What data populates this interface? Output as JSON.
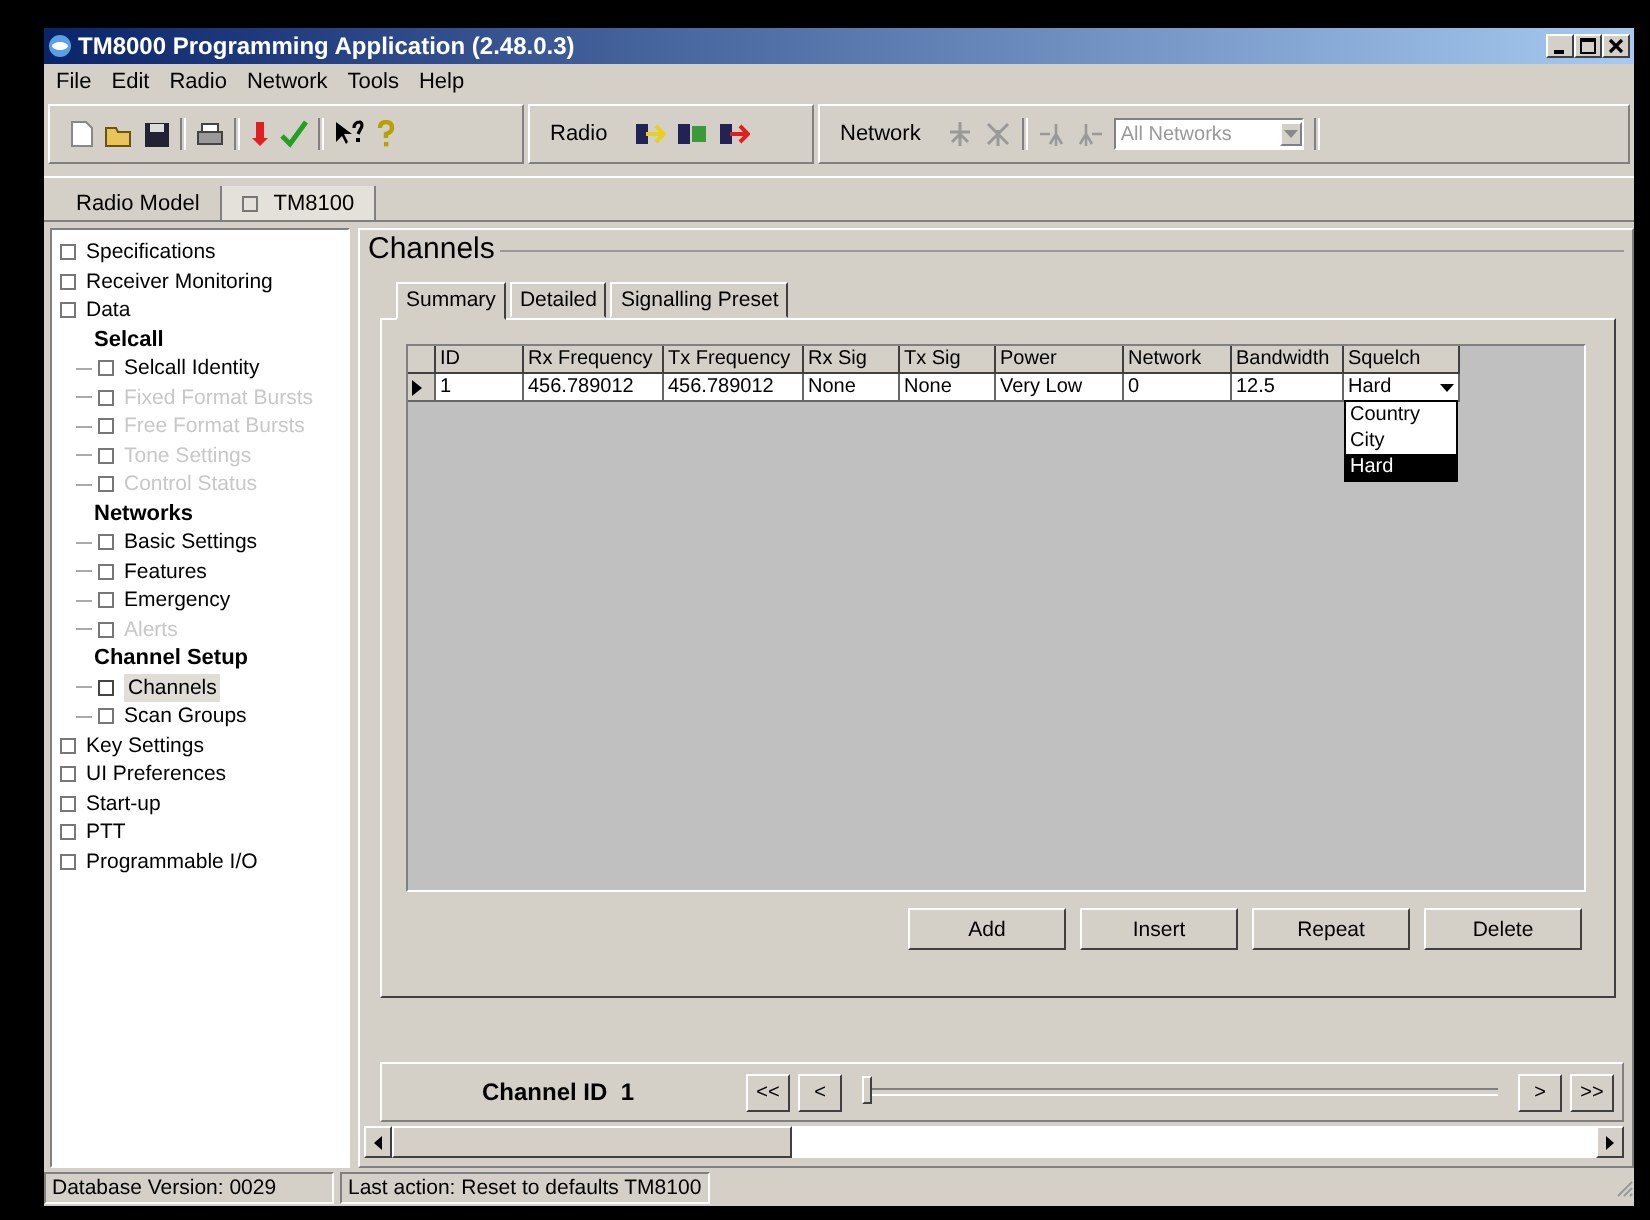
{
  "window": {
    "title": "TM8000 Programming Application (2.48.0.3)"
  },
  "menu": [
    "File",
    "Edit",
    "Radio",
    "Network",
    "Tools",
    "Help"
  ],
  "toolbar": {
    "radio_label": "Radio",
    "network_label": "Network",
    "network_select": {
      "value": "All Networks",
      "disabled": true
    }
  },
  "model_tabs": [
    {
      "label": "Radio Model",
      "selected": false
    },
    {
      "label": "TM8100",
      "selected": true
    }
  ],
  "sidebar": {
    "items": [
      {
        "kind": "item",
        "label": "Specifications",
        "disabled": false,
        "selected": false
      },
      {
        "kind": "item",
        "label": "Receiver Monitoring",
        "disabled": false,
        "selected": false
      },
      {
        "kind": "item",
        "label": "Data",
        "disabled": false,
        "selected": false
      },
      {
        "kind": "group",
        "label": "Selcall",
        "children": [
          {
            "label": "Selcall Identity",
            "disabled": false,
            "selected": false
          },
          {
            "label": "Fixed Format Bursts",
            "disabled": true,
            "selected": false
          },
          {
            "label": "Free Format Bursts",
            "disabled": true,
            "selected": false
          },
          {
            "label": "Tone Settings",
            "disabled": true,
            "selected": false
          },
          {
            "label": "Control Status",
            "disabled": true,
            "selected": false
          }
        ]
      },
      {
        "kind": "group",
        "label": "Networks",
        "children": [
          {
            "label": "Basic Settings",
            "disabled": false,
            "selected": false
          },
          {
            "label": "Features",
            "disabled": false,
            "selected": false
          },
          {
            "label": "Emergency",
            "disabled": false,
            "selected": false
          },
          {
            "label": "Alerts",
            "disabled": true,
            "selected": false
          }
        ]
      },
      {
        "kind": "group",
        "label": "Channel Setup",
        "children": [
          {
            "label": "Channels",
            "disabled": false,
            "selected": true
          },
          {
            "label": "Scan Groups",
            "disabled": false,
            "selected": false
          }
        ]
      },
      {
        "kind": "item",
        "label": "Key Settings",
        "disabled": false,
        "selected": false
      },
      {
        "kind": "item",
        "label": "UI Preferences",
        "disabled": false,
        "selected": false
      },
      {
        "kind": "item",
        "label": "Start-up",
        "disabled": false,
        "selected": false
      },
      {
        "kind": "item",
        "label": "PTT",
        "disabled": false,
        "selected": false
      },
      {
        "kind": "item",
        "label": "Programmable I/O",
        "disabled": false,
        "selected": false
      }
    ]
  },
  "panel": {
    "title": "Channels",
    "tabs": [
      {
        "label": "Summary",
        "selected": true
      },
      {
        "label": "Detailed",
        "selected": false
      },
      {
        "label": "Signalling Preset",
        "selected": false
      }
    ],
    "table": {
      "columns": [
        "ID",
        "Rx Frequency",
        "Tx Frequency",
        "Rx Sig",
        "Tx Sig",
        "Power",
        "Network",
        "Bandwidth",
        "Squelch"
      ],
      "rows": [
        {
          "selected": true,
          "cells": [
            "1",
            "456.789012",
            "456.789012",
            "None",
            "None",
            "Very Low",
            "0",
            "12.5",
            "Hard"
          ]
        }
      ],
      "dropdown": {
        "options": [
          {
            "label": "Country",
            "selected": false
          },
          {
            "label": "City",
            "selected": false
          },
          {
            "label": "Hard",
            "selected": true
          }
        ]
      }
    },
    "buttons": [
      "Add",
      "Insert",
      "Repeat",
      "Delete"
    ]
  },
  "navigator": {
    "label": "Channel ID  1",
    "buttons": [
      "<<",
      "<",
      ">",
      ">>"
    ],
    "slider": {
      "level": 0
    }
  },
  "status_bar": [
    "Database Version: 0029",
    "Last action: Reset to defaults TM8100"
  ]
}
